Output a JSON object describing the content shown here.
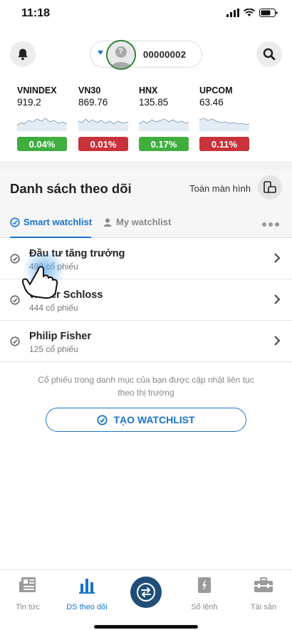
{
  "status_bar": {
    "time": "11:18"
  },
  "header": {
    "account_number": "00000002",
    "avatar_mark": "?"
  },
  "indices": [
    {
      "name": "VNINDEX",
      "value": "919.2",
      "change": "0.04%",
      "change_color": "#3fae3f"
    },
    {
      "name": "VN30",
      "value": "869.76",
      "change": "0.01%",
      "change_color": "#c8323a"
    },
    {
      "name": "HNX",
      "value": "135.85",
      "change": "0.17%",
      "change_color": "#3fae3f"
    },
    {
      "name": "UPCOM",
      "value": "63.46",
      "change": "0.11%",
      "change_color": "#c8323a"
    }
  ],
  "watchlist": {
    "title": "Danh sách theo dõi",
    "fullscreen_label": "Toàn màn hình",
    "tabs": [
      {
        "label": "Smart watchlist",
        "active": true
      },
      {
        "label": "My watchlist",
        "active": false
      }
    ],
    "items": [
      {
        "name": "Đầu tư tăng trưởng",
        "count": "493 cổ phiếu"
      },
      {
        "name": "Walter Schloss",
        "count": "444 cổ phiếu"
      },
      {
        "name": "Philip Fisher",
        "count": "125 cổ phiếu"
      }
    ],
    "footnote_line1": "Cổ phiếu trong danh mục của bạn được cập nhật liên tục",
    "footnote_line2": "theo thị trường",
    "create_label": "TẠO WATCHLIST"
  },
  "bottom_nav": [
    {
      "label": "Tin tức",
      "icon": "newspaper-icon",
      "active": false
    },
    {
      "label": "DS theo dõi",
      "icon": "bar-chart-icon",
      "active": true
    },
    {
      "label": "",
      "icon": "exchange-icon",
      "active": false
    },
    {
      "label": "Sổ lệnh",
      "icon": "order-book-icon",
      "active": false
    },
    {
      "label": "Tài sản",
      "icon": "briefcase-icon",
      "active": false
    }
  ],
  "colors": {
    "accent": "#1a73c8",
    "up": "#3fae3f",
    "down": "#c8323a",
    "nav_center": "#1f4e79"
  }
}
